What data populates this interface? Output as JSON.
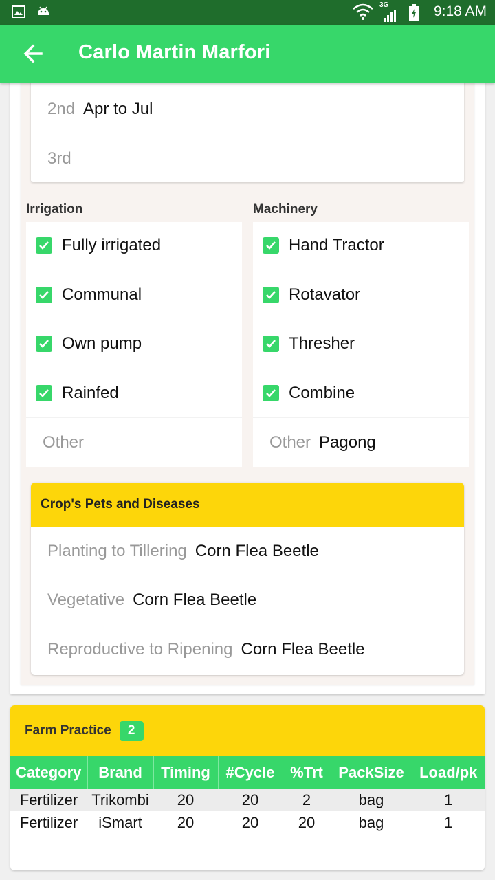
{
  "status_bar": {
    "time": "9:18 AM",
    "network": "3G"
  },
  "app_bar": {
    "title": "Carlo Martin Marfori"
  },
  "seasons": [
    {
      "label": "2nd",
      "value": "Apr to Jul"
    },
    {
      "label": "3rd",
      "value": ""
    }
  ],
  "irrigation": {
    "title": "Irrigation",
    "options": [
      {
        "label": "Fully irrigated",
        "checked": true
      },
      {
        "label": "Communal",
        "checked": true
      },
      {
        "label": "Own pump",
        "checked": true
      },
      {
        "label": "Rainfed",
        "checked": true
      }
    ],
    "other_label": "Other",
    "other_value": ""
  },
  "machinery": {
    "title": "Machinery",
    "options": [
      {
        "label": "Hand Tractor",
        "checked": true
      },
      {
        "label": "Rotavator",
        "checked": true
      },
      {
        "label": "Thresher",
        "checked": true
      },
      {
        "label": "Combine",
        "checked": true
      }
    ],
    "other_label": "Other",
    "other_value": "Pagong"
  },
  "pests": {
    "title": "Crop's Pets and Diseases",
    "rows": [
      {
        "label": "Planting to Tillering",
        "value": "Corn Flea Beetle"
      },
      {
        "label": "Vegetative",
        "value": "Corn Flea Beetle"
      },
      {
        "label": "Reproductive to Ripening",
        "value": "Corn Flea Beetle"
      }
    ]
  },
  "farm_practice": {
    "title": "Farm Practice",
    "count": "2",
    "columns": [
      "Category",
      "Brand",
      "Timing",
      "#Cycle",
      "%Trt",
      "PackSize",
      "Load/pk"
    ],
    "rows": [
      [
        "Fertilizer",
        "Trikombi",
        "20",
        "20",
        "2",
        "bag",
        "1"
      ],
      [
        "Fertilizer",
        "iSmart",
        "20",
        "20",
        "20",
        "bag",
        "1"
      ]
    ]
  },
  "colors": {
    "primary": "#37d76a",
    "status_bar": "#1f6d2c",
    "header_yellow": "#fdd60a"
  }
}
